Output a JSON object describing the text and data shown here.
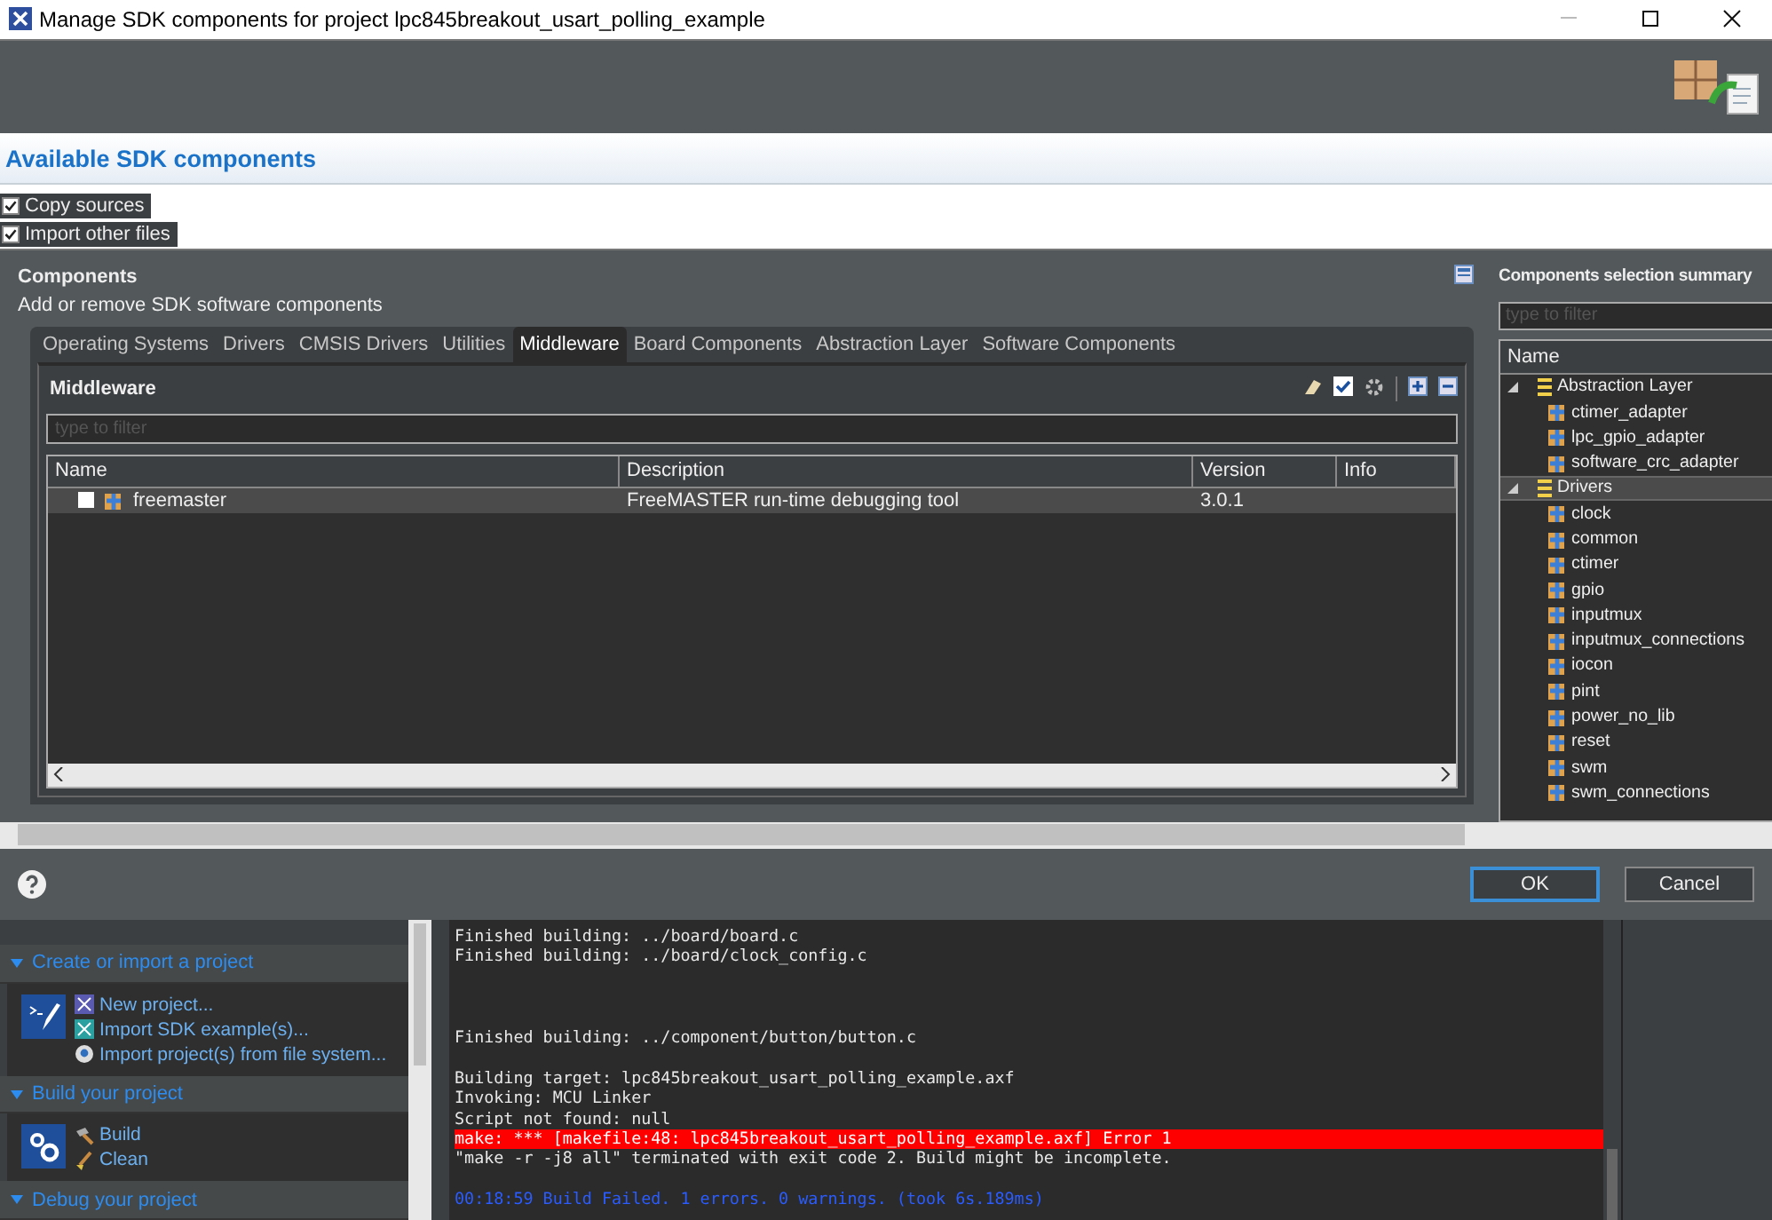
{
  "window": {
    "title": "Manage SDK components for project lpc845breakout_usart_polling_example"
  },
  "header": {
    "title": "Available SDK components"
  },
  "options": [
    {
      "label": "Copy sources",
      "checked": true
    },
    {
      "label": "Import other files",
      "checked": true
    }
  ],
  "components": {
    "title": "Components",
    "subtitle": "Add or remove SDK software components",
    "tabs": [
      {
        "label": "Operating Systems",
        "selected": false
      },
      {
        "label": "Drivers",
        "selected": false
      },
      {
        "label": "CMSIS Drivers",
        "selected": false
      },
      {
        "label": "Utilities",
        "selected": false
      },
      {
        "label": "Middleware",
        "selected": true
      },
      {
        "label": "Board Components",
        "selected": false
      },
      {
        "label": "Abstraction Layer",
        "selected": false
      },
      {
        "label": "Software Components",
        "selected": false
      }
    ],
    "section_title": "Middleware",
    "filter": {
      "placeholder": "type to filter"
    },
    "table": {
      "columns": [
        "Name",
        "Description",
        "Version",
        "Info"
      ],
      "rows": [
        {
          "name": "freemaster",
          "description": "FreeMASTER run-time debugging tool",
          "version": "3.0.1",
          "checked": false,
          "selected": true
        }
      ]
    }
  },
  "summary": {
    "title": "Components selection summary",
    "filter": {
      "placeholder": "type to filter"
    },
    "column": "Name",
    "tree": [
      {
        "label": "Abstraction Layer",
        "expanded": true,
        "selected": false,
        "children": [
          {
            "label": "ctimer_adapter",
            "selected": false
          },
          {
            "label": "lpc_gpio_adapter",
            "selected": false
          },
          {
            "label": "software_crc_adapter",
            "selected": false
          }
        ]
      },
      {
        "label": "Drivers",
        "expanded": true,
        "selected": true,
        "children": [
          {
            "label": "clock",
            "selected": false
          },
          {
            "label": "common",
            "selected": false
          },
          {
            "label": "ctimer",
            "selected": false
          },
          {
            "label": "gpio",
            "selected": false
          },
          {
            "label": "inputmux",
            "selected": false
          },
          {
            "label": "inputmux_connections",
            "selected": false
          },
          {
            "label": "iocon",
            "selected": false
          },
          {
            "label": "pint",
            "selected": false
          },
          {
            "label": "power_no_lib",
            "selected": false
          },
          {
            "label": "reset",
            "selected": false
          },
          {
            "label": "swm",
            "selected": false
          },
          {
            "label": "swm_connections",
            "selected": false
          }
        ]
      }
    ]
  },
  "buttons": [
    {
      "label": "OK",
      "default": true
    },
    {
      "label": "Cancel",
      "default": false
    }
  ],
  "ide": {
    "sections": [
      {
        "title": "Create or import a project",
        "links": [
          {
            "label": "New project...",
            "kind": "new"
          },
          {
            "label": "Import SDK example(s)...",
            "kind": "sdk"
          },
          {
            "label": "Import project(s) from file system...",
            "kind": "import"
          }
        ]
      },
      {
        "title": "Build your project",
        "links": [
          {
            "label": "Build",
            "kind": "build"
          },
          {
            "label": "Clean",
            "kind": "clean"
          }
        ]
      },
      {
        "title": "Debug your project"
      }
    ],
    "console": [
      {
        "kind": "text",
        "text": "Finished building: ../board/board.c"
      },
      {
        "kind": "text",
        "text": "Finished building: ../board/clock_config.c"
      },
      {
        "kind": "blank"
      },
      {
        "kind": "blank"
      },
      {
        "kind": "blank"
      },
      {
        "kind": "text",
        "text": "Finished building: ../component/button/button.c"
      },
      {
        "kind": "blank"
      },
      {
        "kind": "text",
        "text": "Building target: lpc845breakout_usart_polling_example.axf"
      },
      {
        "kind": "text",
        "text": "Invoking: MCU Linker"
      },
      {
        "kind": "text",
        "text": "Script not found: null"
      },
      {
        "kind": "error",
        "text": "make: *** [makefile:48: lpc845breakout_usart_polling_example.axf] Error 1"
      },
      {
        "kind": "text",
        "text": "\"make -r -j8 all\" terminated with exit code 2. Build might be incomplete."
      },
      {
        "kind": "blank"
      },
      {
        "kind": "status",
        "text": "00:18:59 Build Failed. 1 errors. 0 warnings. (took 6s.189ms)"
      }
    ]
  }
}
